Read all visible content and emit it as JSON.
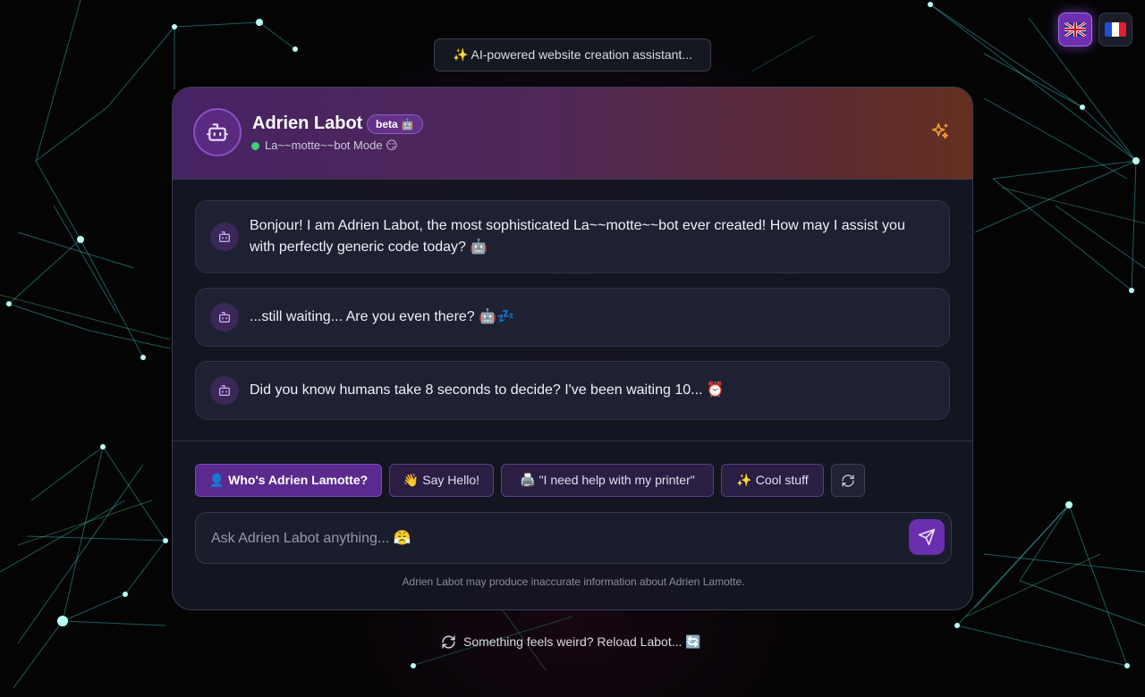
{
  "language_switcher": {
    "options": [
      {
        "code": "en",
        "flag": "🇬🇧",
        "active": true
      },
      {
        "code": "fr",
        "flag": "🇫🇷",
        "active": false
      }
    ]
  },
  "tagline": "✨ AI-powered website creation assistant...",
  "chat": {
    "bot_name": "Adrien Labot",
    "beta_badge": "beta 🤖",
    "mode_text": "La~~motte~~bot Mode 😏",
    "status_color": "#3fcf7a",
    "messages": [
      {
        "sender": "bot",
        "text": "Bonjour! I am Adrien Labot, the most sophisticated La~~motte~~bot ever created! How may I assist you with perfectly generic code today? 🤖"
      },
      {
        "sender": "bot",
        "text": "...still waiting... Are you even there? 🤖💤"
      },
      {
        "sender": "bot",
        "text": "Did you know humans take 8 seconds to decide? I've been waiting 10... ⏰"
      }
    ],
    "suggestions": [
      {
        "label": "👤 Who's Adrien Lamotte?"
      },
      {
        "label": "👋 Say Hello!"
      },
      {
        "label": "🖨️ \"I need help with my printer\""
      },
      {
        "label": "✨ Cool stuff"
      }
    ],
    "input": {
      "placeholder": "Ask Adrien Labot anything... 😤",
      "value": ""
    },
    "disclaimer": "Adrien Labot may produce inaccurate information about Adrien Lamotte."
  },
  "reload_text": "Something feels weird? Reload Labot... 🔄",
  "colors": {
    "accent": "#6a2fae",
    "header_gradient_start": "#462362",
    "header_gradient_end": "#66301f",
    "network_lines": "#46d8d0"
  }
}
